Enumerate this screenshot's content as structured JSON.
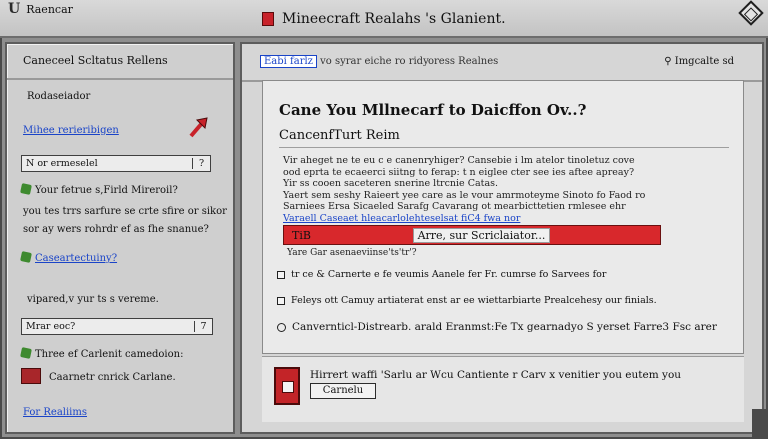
{
  "window": {
    "left_title": "Raencar",
    "center_title": "Mineecraft Realahs 's Glanient."
  },
  "left_panel": {
    "header": "Caneceel Scltatus Rellens",
    "section_label": "Rodaseiador",
    "link": "Mihee rerieribigen",
    "search": {
      "value": "N or ermeselel",
      "suffix": "?"
    },
    "question1": "Your fetrue s,Firld Mireroil?",
    "para1_line1": "you tes trrs sarfure se crte sfire or sikor",
    "para1_line2": "sor ay wers rohrdr ef as fhe snanue?",
    "sub_link": "Caseartectuiny?",
    "plain_line": "vipared,v yur ts s vereme.",
    "input2": {
      "value": "Mrar eoc?",
      "suffix": "7"
    },
    "question2": "Three ef Carlenit camedoion:",
    "red_item": "Caarnetr cnrick Carlane.",
    "footer_link": "For Realiims"
  },
  "right_panel": {
    "tab_selected": "Eabi farlz",
    "tab_sub": "vo syrar eiche ro ridy",
    "tab2": "oress Realnes",
    "help": "Imgcalte sd",
    "title": "Cane You Mllnecarf to Daicffon Ov..?",
    "subtitle": "CancenfTurt Reim",
    "paragraph": [
      "Vir aheget ne te eu c e canenryhiger? Cansebie i lm atelor tinoletuz cove",
      "ood eprta te ecaeerci siitng to ferap: t n eiglee cter see ies aftee apreay?",
      "Yir ss cooen saceteren snerine ltrcnie Catas.",
      "Yaert sem seshy Raieert yee care as le vour amrmoteyme Sinoto fo Faod ro",
      "Sarniees Ersa Sicaeled Sarafg Cavarang ot mearbicttetien rmlesee ehr"
    ],
    "link_line": "Varaell Caseaet hleacarlolehteselsat fiC4 fwa nor",
    "banner_left": "TiB",
    "banner_text": "Arre, sur Scriclaiator...",
    "cancel_note": "Yare Gar asenaeviinse'ts'tr'?",
    "option1": "tr ce & Carnerte e fe veumis Aanele fer Fr. cumrse fo Sarvees for",
    "option2": "Feleys ott Camuy artiaterat enst ar ee wiettarbiarte Prealcehesy our finials.",
    "option3": "Canvernticl-Distrearb. arald Eranmst:Fe Tx gearnadyo S yerset Farre3 Fsc arer",
    "footer_text": "Hirrert waffi 'Sarlu ar Wcu Cantiente r Carv x venitier you eutem you",
    "cancel_button": "Carnelu"
  }
}
